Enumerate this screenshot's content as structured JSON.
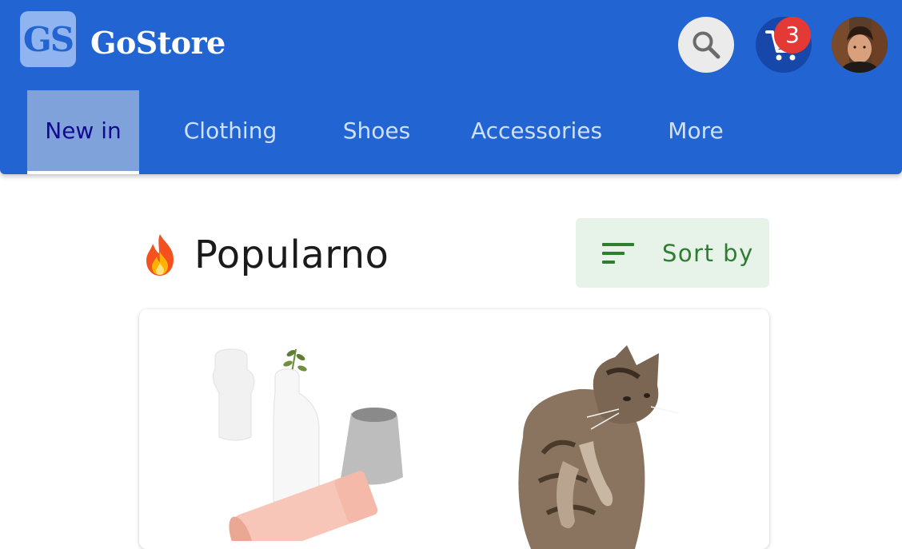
{
  "header": {
    "logo_text": "GS",
    "brand_name": "GoStore",
    "cart_count": "3",
    "search_icon": "search-icon",
    "cart_icon": "cart-icon",
    "avatar": "user-avatar"
  },
  "tabs": [
    {
      "label": "New in",
      "active": true
    },
    {
      "label": "Clothing",
      "active": false
    },
    {
      "label": "Shoes",
      "active": false
    },
    {
      "label": "Accessories",
      "active": false
    },
    {
      "label": "More",
      "active": false
    }
  ],
  "section": {
    "icon": "fire-icon",
    "title": "Popularno"
  },
  "sort": {
    "icon": "sort-icon",
    "label": "Sort by"
  },
  "products": [
    {
      "image": "vases-image"
    },
    {
      "image": "cat-image"
    }
  ],
  "colors": {
    "primary": "#2264d1",
    "accent_green": "#2e7d32",
    "badge_red": "#e53935",
    "active_tab_text": "#120a8f"
  }
}
